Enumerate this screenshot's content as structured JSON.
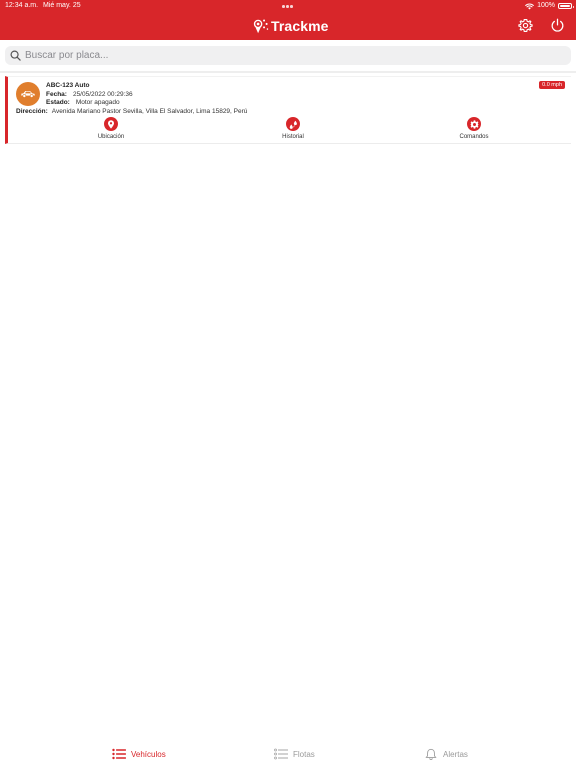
{
  "status_bar": {
    "time": "12:34 a.m.",
    "date": "Mié may. 25",
    "battery": "100%"
  },
  "header": {
    "app_name": "Trackme",
    "brand_color": "#d8262a"
  },
  "search": {
    "placeholder": "Buscar por placa..."
  },
  "vehicle": {
    "plate": "ABC-123 Auto",
    "speed": "0.0 mph",
    "fecha_label": "Fecha:",
    "fecha_value": "25/05/2022 00:29:36",
    "estado_label": "Estado:",
    "estado_value": "Motor apagado",
    "direccion_label": "Dirección:",
    "direccion_value": "Avenida Mariano Pastor Sevilla, Villa El Salvador, Lima 15829, Perú",
    "avatar_color": "#e07e2d",
    "actions": {
      "ubicacion": "Ubicación",
      "historial": "Historial",
      "comandos": "Comandos"
    }
  },
  "tabs": {
    "vehiculos": "Vehículos",
    "flotas": "Flotas",
    "alertas": "Alertas"
  }
}
